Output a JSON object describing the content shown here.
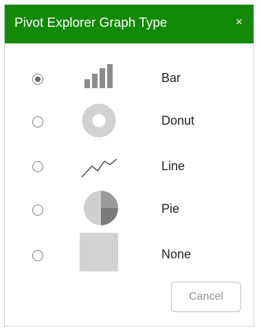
{
  "dialog": {
    "title": "Pivot Explorer Graph Type",
    "close_glyph": "×",
    "header_color": "#138a07"
  },
  "options": [
    {
      "label": "Bar",
      "icon": "bar-chart-icon",
      "selected": true
    },
    {
      "label": "Donut",
      "icon": "donut-chart-icon",
      "selected": false
    },
    {
      "label": "Line",
      "icon": "line-chart-icon",
      "selected": false
    },
    {
      "label": "Pie",
      "icon": "pie-chart-icon",
      "selected": false
    },
    {
      "label": "None",
      "icon": "none-chart-icon",
      "selected": false
    }
  ],
  "footer": {
    "cancel_label": "Cancel"
  }
}
